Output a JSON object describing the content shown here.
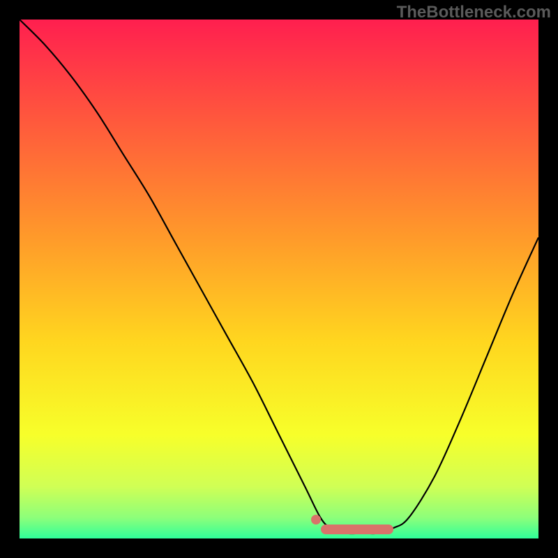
{
  "watermark": "TheBottleneck.com",
  "chart_data": {
    "type": "line",
    "title": "",
    "xlabel": "",
    "ylabel": "",
    "xlim": [
      0,
      100
    ],
    "ylim": [
      0,
      100
    ],
    "x": [
      0,
      5,
      10,
      15,
      20,
      25,
      30,
      35,
      40,
      45,
      50,
      55,
      58,
      60,
      63,
      66,
      69,
      72,
      75,
      80,
      85,
      90,
      95,
      100
    ],
    "values": [
      100,
      95,
      89,
      82,
      74,
      66,
      57,
      48,
      39,
      30,
      20,
      10,
      4,
      2,
      1,
      1,
      1,
      2,
      4,
      12,
      23,
      35,
      47,
      58
    ],
    "highlight_range_x": [
      58,
      72
    ],
    "marker_x": 58,
    "gradient_stops": [
      {
        "pos": 0.0,
        "color": "#ff1f4f"
      },
      {
        "pos": 0.2,
        "color": "#ff5a3c"
      },
      {
        "pos": 0.42,
        "color": "#ff9a2a"
      },
      {
        "pos": 0.62,
        "color": "#ffd61f"
      },
      {
        "pos": 0.8,
        "color": "#f7ff2a"
      },
      {
        "pos": 0.9,
        "color": "#d0ff55"
      },
      {
        "pos": 0.96,
        "color": "#8dff7a"
      },
      {
        "pos": 1.0,
        "color": "#2fff9a"
      }
    ]
  }
}
